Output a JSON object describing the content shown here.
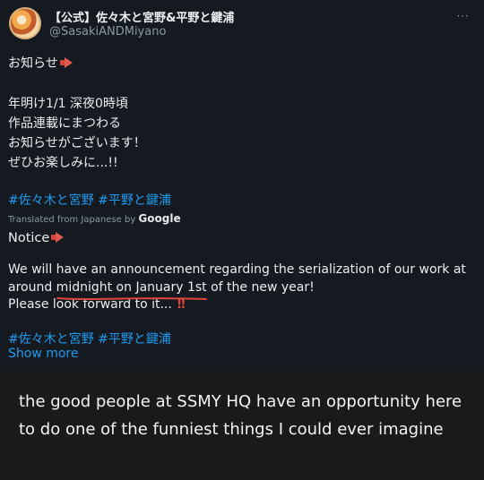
{
  "tweet": {
    "name": "【公式】佐々木と宮野&平野と鍵浦",
    "handle": "@SasakiANDMiyano",
    "more": "···",
    "original": {
      "l1": "お知らせ",
      "l2": "年明け1/1 深夜0時頃",
      "l3": "作品連載にまつわる",
      "l4": "お知らせがございます！",
      "l5": "ぜひお楽しみに...!!",
      "hashtags": "#佐々木と宮野 #平野と鍵浦"
    },
    "translation": {
      "attribution_prefix": "Translated from Japanese by ",
      "attribution_brand": "Google",
      "notice": "Notice",
      "line1": "We will have an announcement regarding the serialization of our work at",
      "line2": "around midnight on January 1st of the new year!",
      "line3": "Please look forward to it...",
      "hashtags": "#佐々木と宮野 #平野と鍵浦",
      "show_more": "Show more"
    }
  },
  "caption": "the good people at SSMY HQ have an opportunity here to do one of the funniest things I could ever imagine",
  "colors": {
    "hashtag": "#1d9bf0",
    "annotation": "#e0463c",
    "background": "#151a21"
  },
  "icons": [
    "megaphone-icon",
    "more-icon",
    "double-exclamation-icon"
  ]
}
